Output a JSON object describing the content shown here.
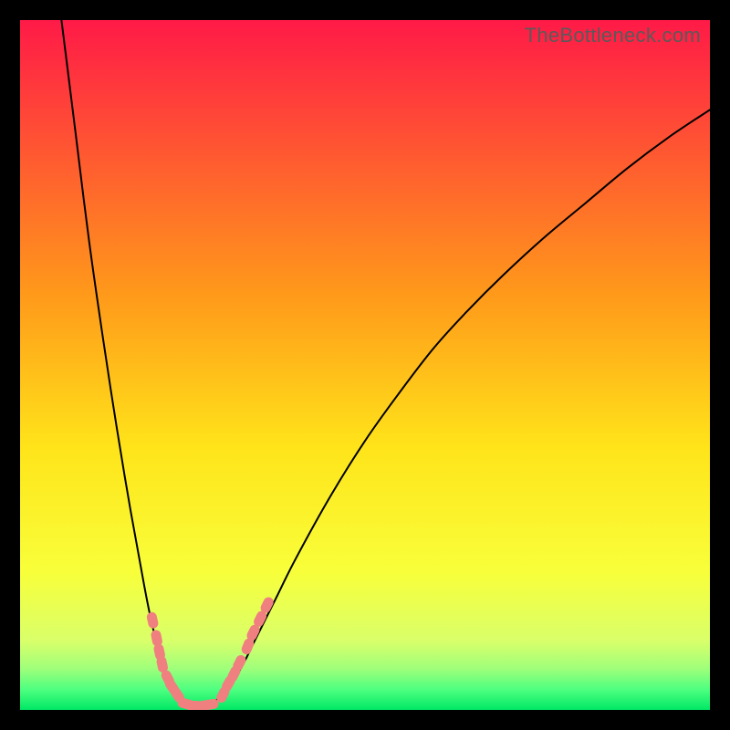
{
  "watermark": "TheBottleneck.com",
  "chart_data": {
    "type": "line",
    "title": "",
    "xlabel": "",
    "ylabel": "",
    "xlim": [
      0,
      100
    ],
    "ylim": [
      0,
      100
    ],
    "grid": false,
    "legend": null,
    "gradient_bands": [
      {
        "y_top": 100,
        "color": "#ff1a47"
      },
      {
        "y_top": 60,
        "color": "#ff9a1a"
      },
      {
        "y_top": 38,
        "color": "#ffe41a"
      },
      {
        "y_top": 20,
        "color": "#f8ff3a"
      },
      {
        "y_top": 10,
        "color": "#d9ff6a"
      },
      {
        "y_top": 6,
        "color": "#9fff7a"
      },
      {
        "y_top": 3,
        "color": "#4fff80"
      },
      {
        "y_top": 0,
        "color": "#00e865"
      }
    ],
    "series": [
      {
        "name": "left-branch",
        "stroke": "#000000",
        "x": [
          6,
          8,
          10,
          12,
          14,
          16,
          18,
          19,
          20,
          21,
          22,
          23,
          24
        ],
        "y": [
          100,
          84,
          68,
          54,
          41,
          29,
          18,
          13,
          9,
          6,
          3.5,
          1.8,
          1.0
        ]
      },
      {
        "name": "right-branch",
        "stroke": "#000000",
        "x": [
          28,
          30,
          32,
          34,
          37,
          40,
          45,
          50,
          55,
          60,
          65,
          70,
          76,
          82,
          88,
          94,
          100
        ],
        "y": [
          1.0,
          3.0,
          6.0,
          10.0,
          16.0,
          22.0,
          31.0,
          39.0,
          46.0,
          52.5,
          58.0,
          63.0,
          68.5,
          73.5,
          78.5,
          83.0,
          87.0
        ]
      },
      {
        "name": "valley-floor",
        "stroke": "#000000",
        "x": [
          24,
          25,
          26,
          27,
          28
        ],
        "y": [
          1.0,
          0.5,
          0.4,
          0.5,
          1.0
        ]
      }
    ],
    "marker_clusters": [
      {
        "name": "left-cluster-upper",
        "color": "#f08080",
        "points": [
          {
            "x": 19.2,
            "y": 13.0
          },
          {
            "x": 19.8,
            "y": 10.4
          },
          {
            "x": 20.2,
            "y": 8.4
          },
          {
            "x": 20.6,
            "y": 6.6
          }
        ]
      },
      {
        "name": "left-cluster-lower",
        "color": "#f08080",
        "points": [
          {
            "x": 21.4,
            "y": 4.6
          },
          {
            "x": 22.0,
            "y": 3.4
          },
          {
            "x": 22.8,
            "y": 2.2
          }
        ]
      },
      {
        "name": "floor-cluster",
        "color": "#f08080",
        "points": [
          {
            "x": 24.0,
            "y": 0.9
          },
          {
            "x": 25.2,
            "y": 0.6
          },
          {
            "x": 26.4,
            "y": 0.6
          },
          {
            "x": 27.6,
            "y": 0.8
          }
        ]
      },
      {
        "name": "right-cluster-lower",
        "color": "#f08080",
        "points": [
          {
            "x": 29.4,
            "y": 2.2
          },
          {
            "x": 30.2,
            "y": 3.8
          },
          {
            "x": 31.0,
            "y": 5.2
          },
          {
            "x": 31.8,
            "y": 6.8
          }
        ]
      },
      {
        "name": "right-cluster-upper",
        "color": "#f08080",
        "points": [
          {
            "x": 33.0,
            "y": 9.2
          },
          {
            "x": 33.8,
            "y": 11.2
          },
          {
            "x": 34.8,
            "y": 13.2
          },
          {
            "x": 35.8,
            "y": 15.2
          }
        ]
      }
    ]
  }
}
